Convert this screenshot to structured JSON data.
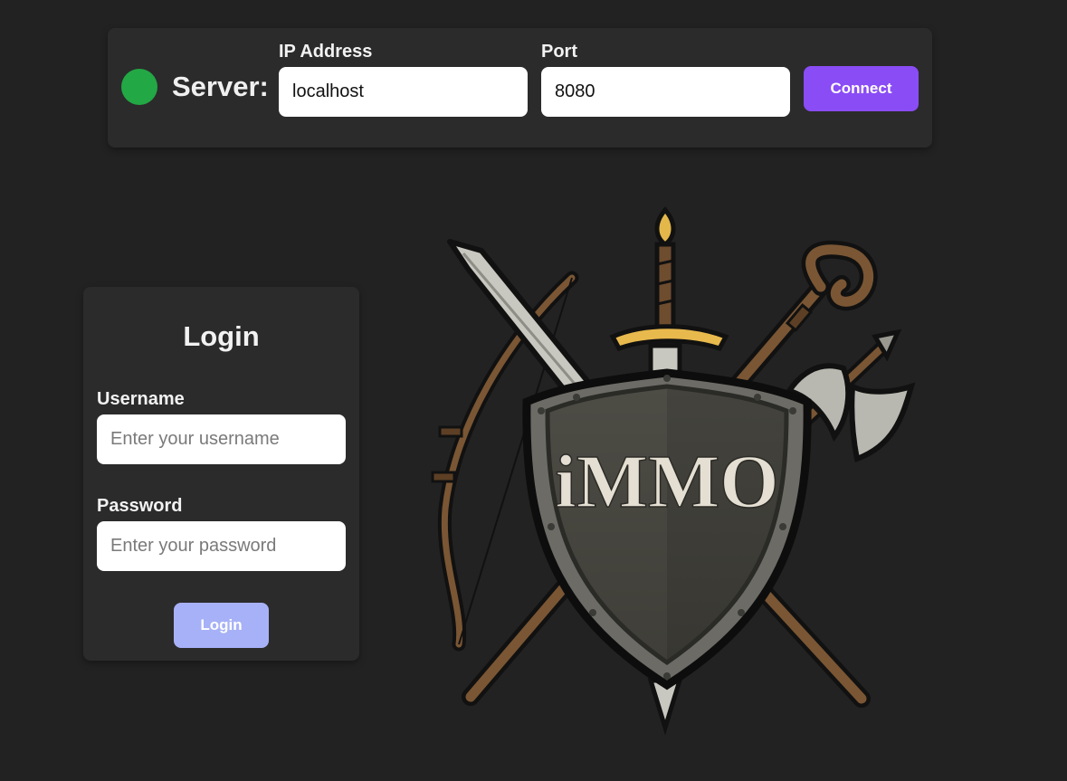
{
  "server": {
    "label": "Server:",
    "status_color": "#22a845",
    "ip": {
      "label": "IP Address",
      "value": "localhost",
      "placeholder": ""
    },
    "port": {
      "label": "Port",
      "value": "8080",
      "placeholder": ""
    },
    "connect_label": "Connect",
    "connect_color": "#8a4cf5"
  },
  "login": {
    "title": "Login",
    "username": {
      "label": "Username",
      "value": "",
      "placeholder": "Enter your username"
    },
    "password": {
      "label": "Password",
      "value": "",
      "placeholder": "Enter your password"
    },
    "button_label": "Login",
    "button_color": "#a7b1f7"
  },
  "logo": {
    "text": "iMMO",
    "icon": "shield-crossed-weapons-icon"
  }
}
